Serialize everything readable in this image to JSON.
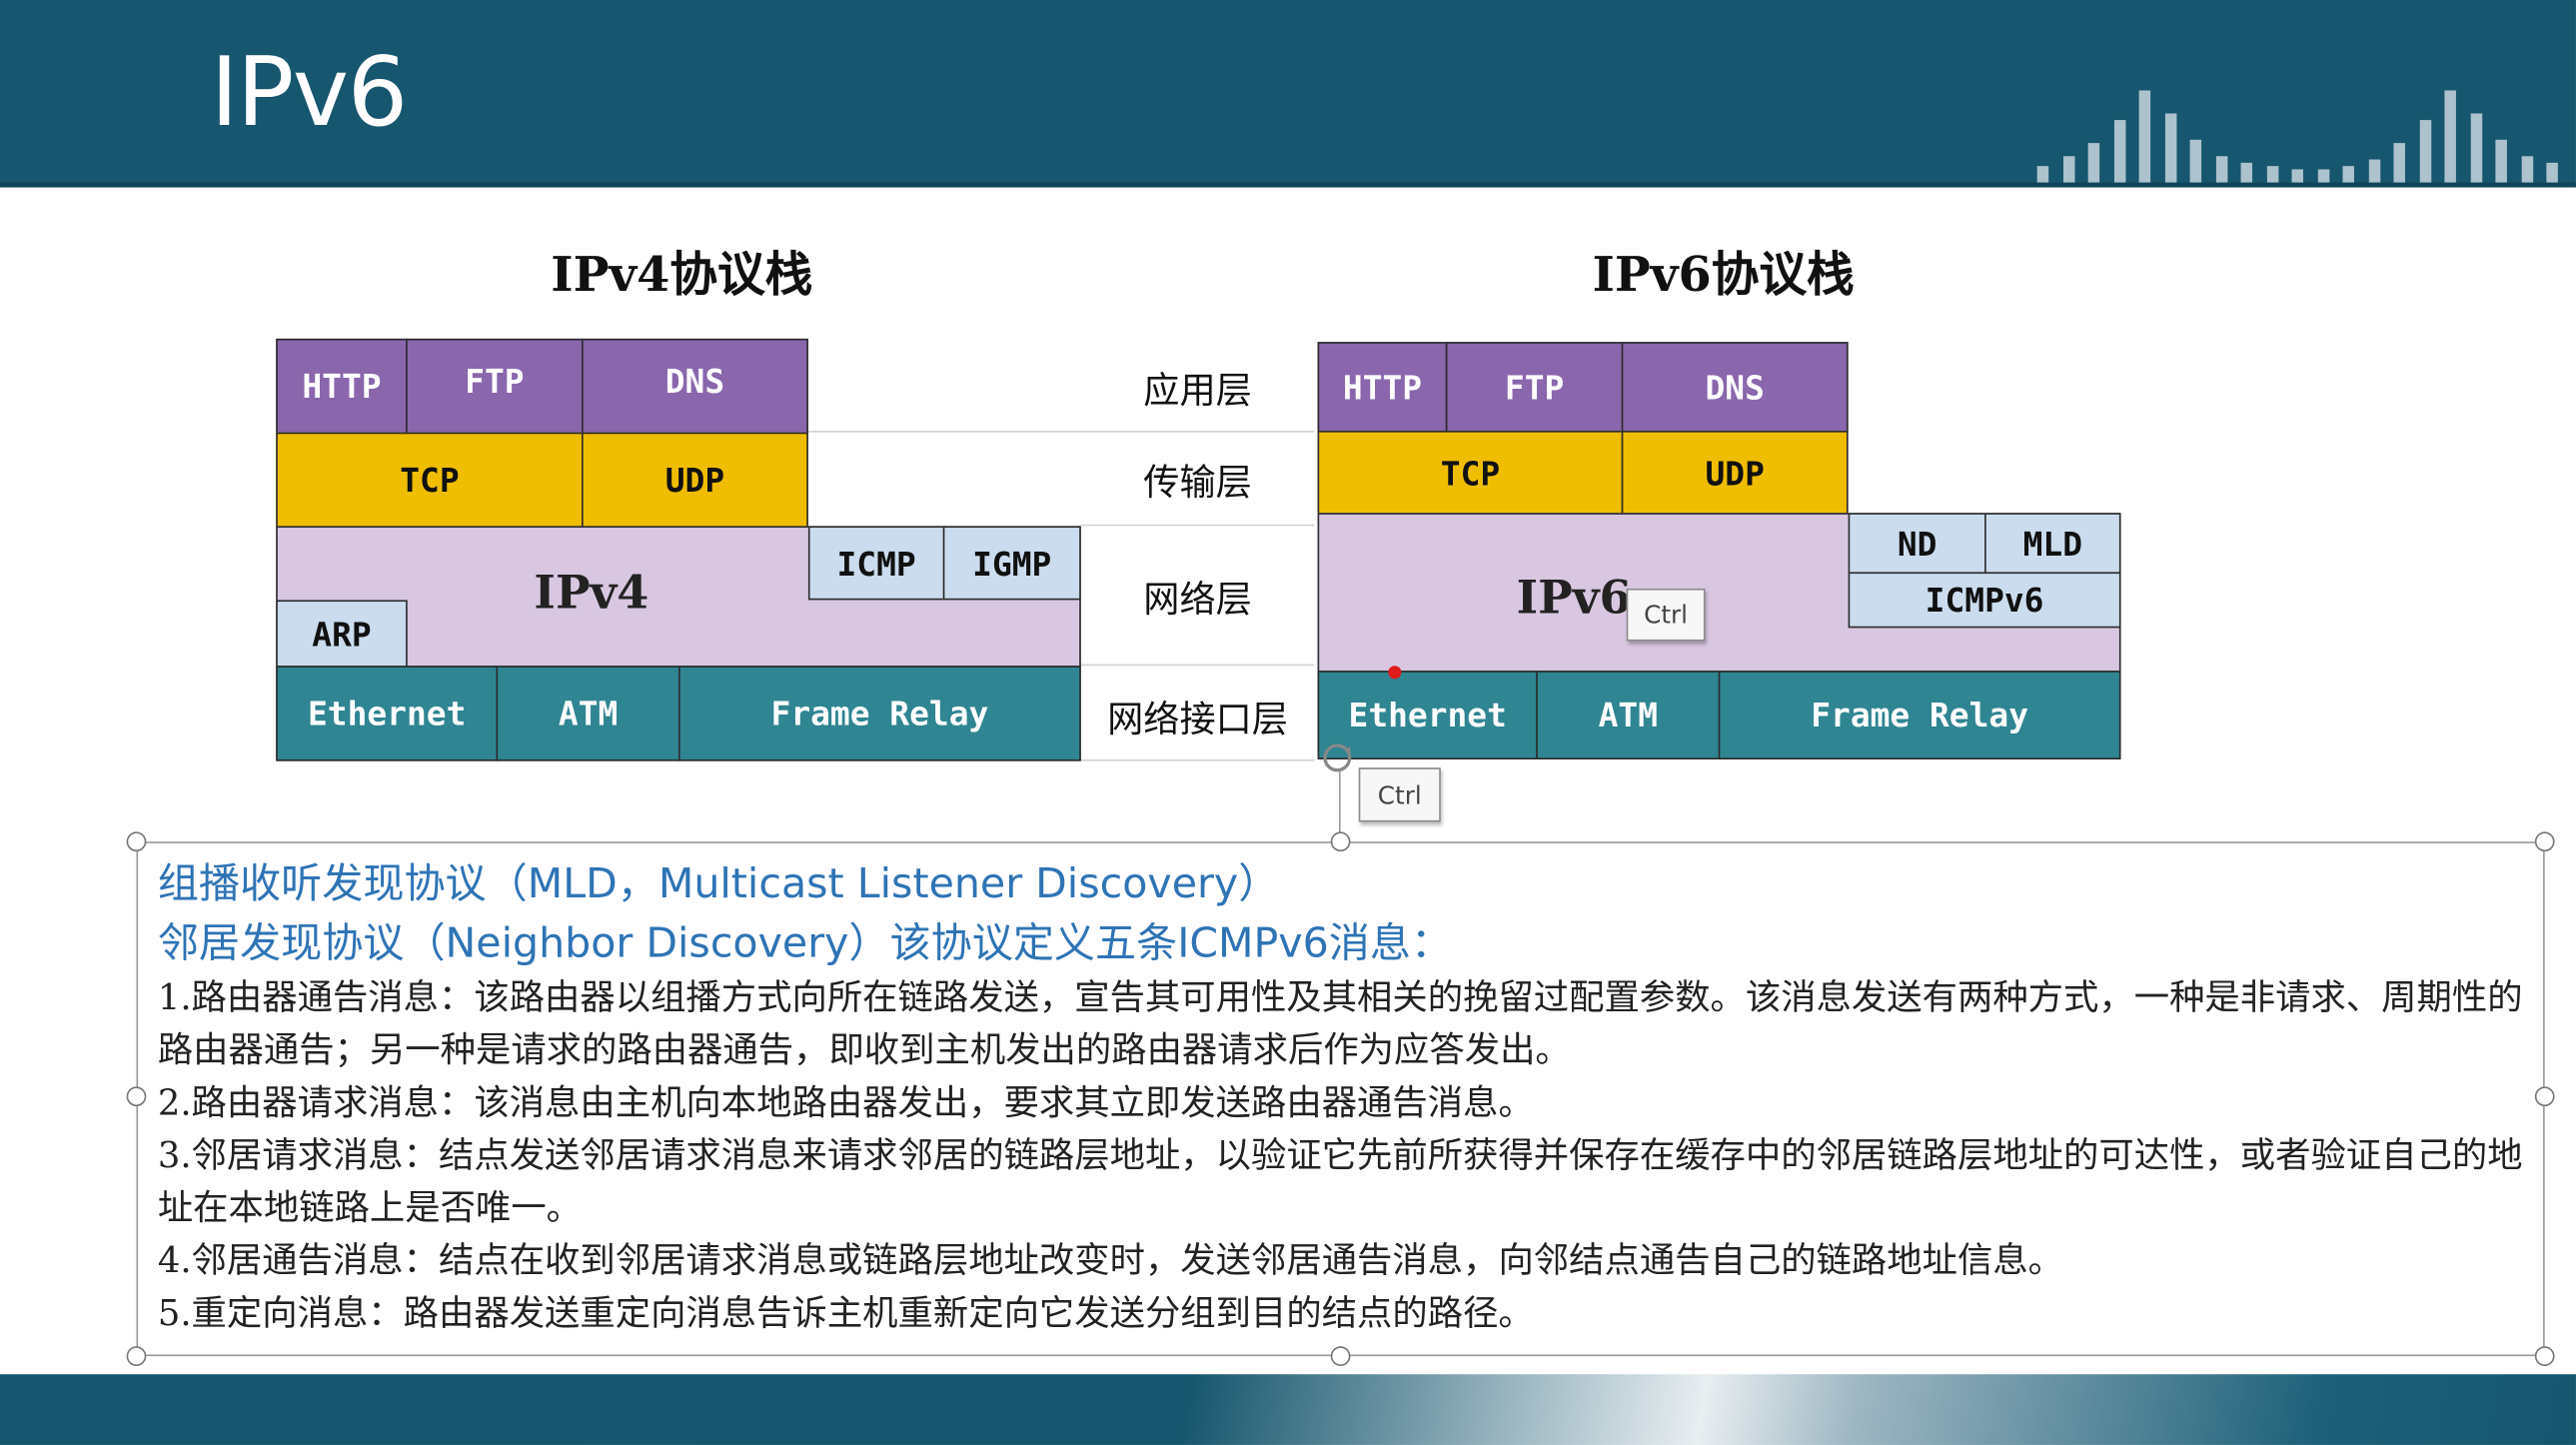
{
  "slide": {
    "title": "IPv6"
  },
  "ipv4_stack": {
    "title": "IPv4协议栈",
    "application": [
      "HTTP",
      "FTP",
      "DNS"
    ],
    "transport": [
      "TCP",
      "UDP"
    ],
    "network": {
      "main": "IPv4",
      "arp": "ARP",
      "icmp": "ICMP",
      "igmp": "IGMP"
    },
    "link": [
      "Ethernet",
      "ATM",
      "Frame Relay"
    ]
  },
  "ipv6_stack": {
    "title": "IPv6协议栈",
    "application": [
      "HTTP",
      "FTP",
      "DNS"
    ],
    "transport": [
      "TCP",
      "UDP"
    ],
    "network": {
      "main": "IPv6",
      "nd": "ND",
      "mld": "MLD",
      "icmpv6": "ICMPv6"
    },
    "link": [
      "Ethernet",
      "ATM",
      "Frame Relay"
    ]
  },
  "layers": [
    "应用层",
    "传输层",
    "网络层",
    "网络接口层"
  ],
  "tooltips": {
    "ctrl_1": "Ctrl",
    "ctrl_2": "Ctrl"
  },
  "text": {
    "heading_1": "组播收听发现协议（MLD，Multicast Listener Discovery）",
    "heading_2": "邻居发现协议（Neighbor Discovery）该协议定义五条ICMPv6消息：",
    "items": [
      "1.路由器通告消息：该路由器以组播方式向所在链路发送，宣告其可用性及其相关的挽留过配置参数。该消息发送有两种方式，一种是非请求、周期性的路由器通告；另一种是请求的路由器通告，即收到主机发出的路由器请求后作为应答发出。",
      "2.路由器请求消息：该消息由主机向本地路由器发出，要求其立即发送路由器通告消息。",
      "3.邻居请求消息：结点发送邻居请求消息来请求邻居的链路层地址，以验证它先前所获得并保存在缓存中的邻居链路层地址的可达性，或者验证自己的地址在本地链路上是否唯一。",
      "4.邻居通告消息：结点在收到邻居请求消息或链路层地址改变时，发送邻居通告消息，向邻结点通告自己的链路地址信息。",
      "5.重定向消息：路由器发送重定向消息告诉主机重新定向它发送分组到目的结点的路径。"
    ]
  },
  "colors": {
    "header": "#16566e",
    "application_layer": "#8a66ad",
    "transport_layer": "#f0be00",
    "network_layer": "#d9c7e2",
    "link_layer": "#2f8592",
    "icmp_boxes": "#cbdcee",
    "text_heading": "#2e74b5"
  }
}
